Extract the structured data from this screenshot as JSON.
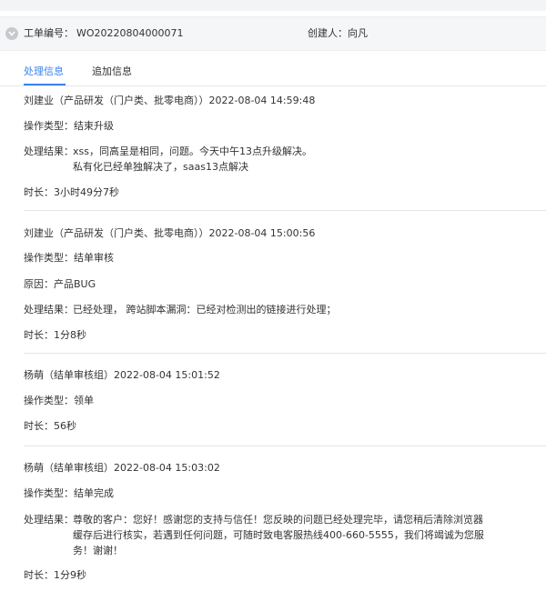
{
  "header": {
    "ticket_label": "工单编号：",
    "ticket_no": "WO20220804000071",
    "creator_label": "创建人：",
    "creator": "向凡"
  },
  "tabs": [
    {
      "label": "处理信息",
      "active": true
    },
    {
      "label": "追加信息",
      "active": false
    }
  ],
  "records": [
    {
      "header": "刘建业（产品研发（门户类、批零电商））2022-08-04 14:59:48",
      "op_type": "操作类型：结束升级",
      "result_label": "处理结果：",
      "result_lines": [
        "xss，同高呈是相同，问题。今天中午13点升级解决。",
        "私有化已经单独解决了，saas13点解决"
      ],
      "duration": "时长：3小时49分7秒"
    },
    {
      "header": "刘建业（产品研发（门户类、批零电商））2022-08-04 15:00:56",
      "op_type": "操作类型：结单审核",
      "reason": "原因：产品BUG",
      "result_label": "处理结果：",
      "result_lines": [
        "已经处理， 跨站脚本漏洞：已经对检测出的链接进行处理；"
      ],
      "duration": "时长：1分8秒"
    },
    {
      "header": "杨萌（结单审核组）2022-08-04 15:01:52",
      "op_type": "操作类型：领单",
      "duration": "时长：56秒"
    },
    {
      "header": "杨萌（结单审核组）2022-08-04 15:03:02",
      "op_type": "操作类型：结单完成",
      "result_label": "处理结果：",
      "result_lines": [
        "尊敬的客户：您好！感谢您的支持与信任！您反映的问题已经处理完毕，请您稍后清除浏览器",
        "缓存后进行核实，若遇到任何问题，可随时致电客服热线400-660-5555，我们将竭诚为您服",
        "务！谢谢！"
      ],
      "duration": "时长：1分9秒"
    }
  ]
}
